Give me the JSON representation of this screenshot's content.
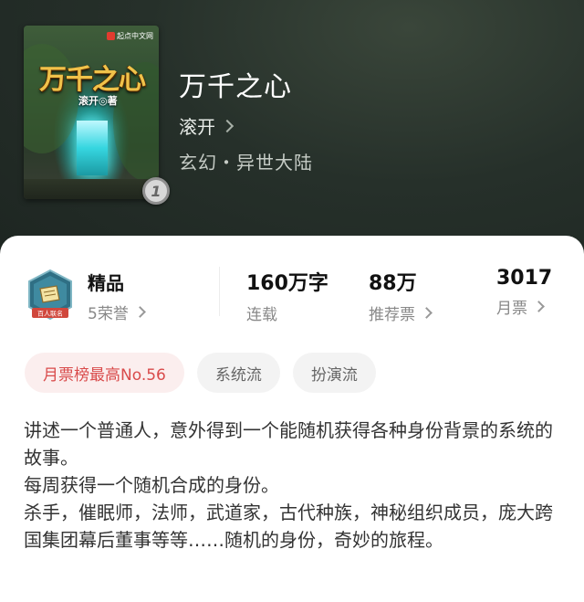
{
  "book": {
    "cover_title": "万千之心",
    "cover_author": "滚开◎著",
    "cover_publisher": "起点中文网",
    "volume_badge": "1",
    "title": "万千之心",
    "author": "滚开",
    "genre": "玄幻・异世大陆"
  },
  "honor": {
    "badge_text": "百人联名",
    "title": "精品",
    "subtitle": "5荣誉"
  },
  "stats": [
    {
      "value": "160万字",
      "label": "连载"
    },
    {
      "value": "88万",
      "label": "推荐票"
    },
    {
      "value": "3017",
      "label": "月票"
    }
  ],
  "tags": [
    "月票榜最高No.56",
    "系统流",
    "扮演流"
  ],
  "description": [
    "讲述一个普通人，意外得到一个能随机获得各种身份背景的系统的故事。",
    "每周获得一个随机合成的身份。",
    "杀手，催眠师，法师，武道家，古代种族，神秘组织成员，庞大跨国集团幕后董事等等……随机的身份，奇妙的旅程。"
  ],
  "colors": {
    "header_bg": "#26302a",
    "hot_tag_bg": "#fbeeee",
    "hot_tag_text": "#d94b4b",
    "honor_accent": "#d0473c"
  }
}
